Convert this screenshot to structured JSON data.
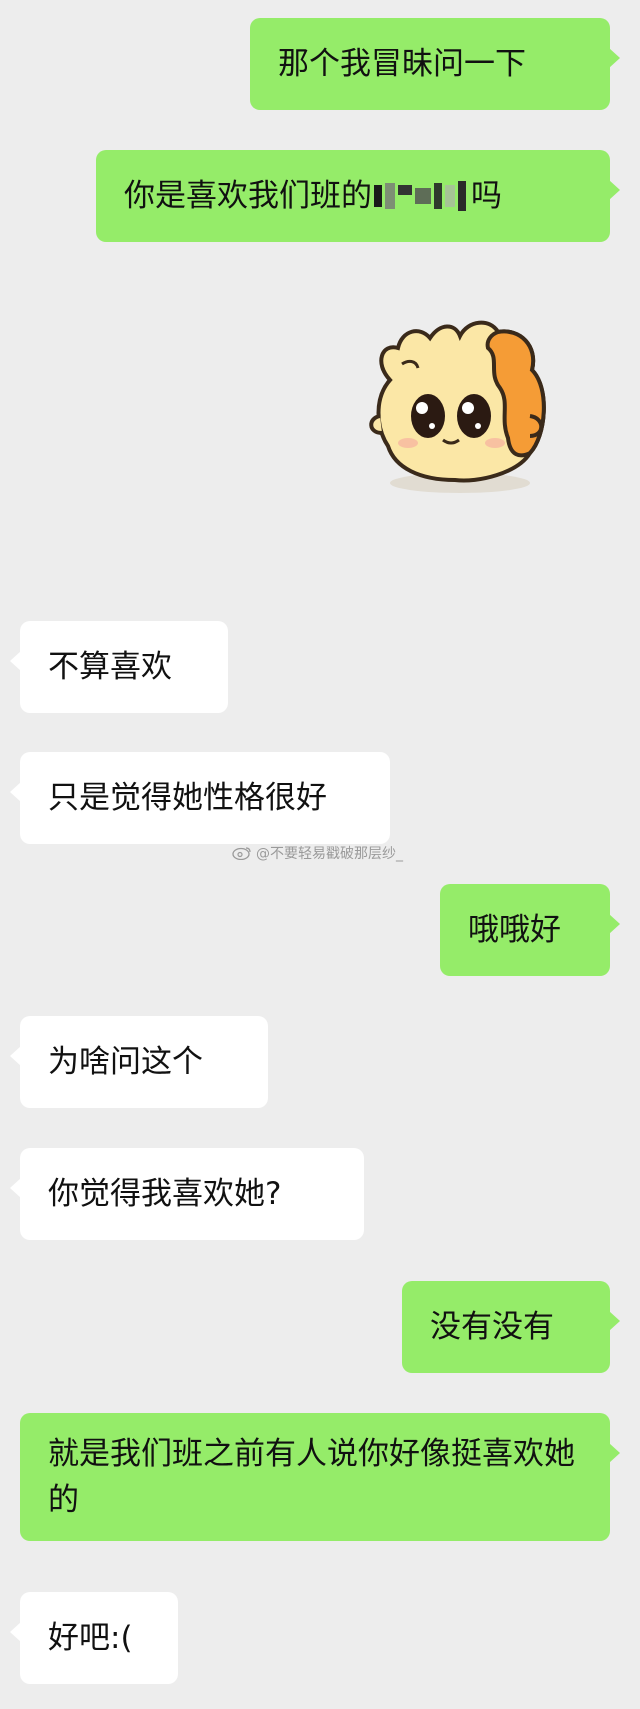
{
  "chat": {
    "messages": [
      {
        "from": "me",
        "text": "那个我冒昧问一下"
      },
      {
        "from": "me",
        "text_before": "你是喜欢我们班的",
        "text_after": "吗"
      },
      {
        "from": "me",
        "type": "sticker",
        "sticker": "hamster-sticker"
      },
      {
        "from": "them",
        "text": "不算喜欢"
      },
      {
        "from": "them",
        "text": "只是觉得她性格很好"
      },
      {
        "from": "me",
        "text": "哦哦好"
      },
      {
        "from": "them",
        "text": "为啥问这个"
      },
      {
        "from": "them",
        "text": "你觉得我喜欢她?"
      },
      {
        "from": "me",
        "text": "没有没有"
      },
      {
        "from": "me",
        "text": "就是我们班之前有人说你好像挺喜欢她的"
      },
      {
        "from": "them",
        "text": "好吧:("
      }
    ]
  },
  "watermark": {
    "text": "@不要轻易戳破那层纱_",
    "icon": "weibo-icon"
  },
  "colors": {
    "background": "#ededed",
    "my_bubble": "#95ec69",
    "their_bubble": "#ffffff",
    "text": "#111111"
  }
}
